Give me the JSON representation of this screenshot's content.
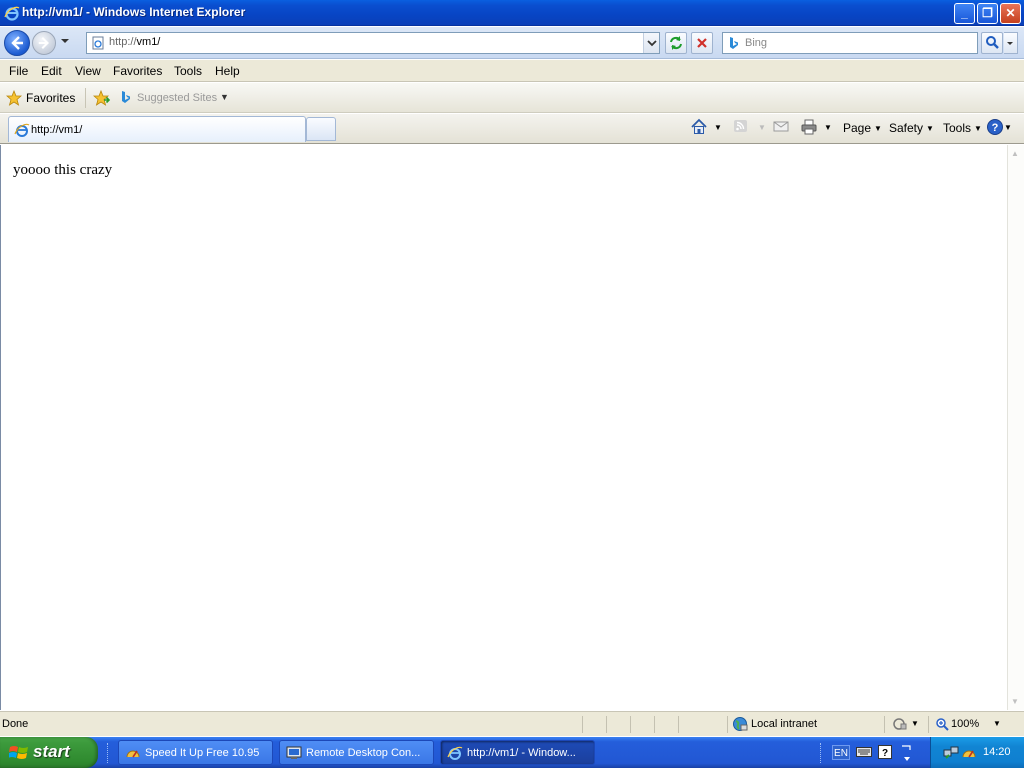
{
  "window": {
    "title": "http://vm1/ - Windows Internet Explorer",
    "minimize": "_",
    "restore": "❐",
    "close": "✕"
  },
  "address": {
    "url_prefix": "http://",
    "url_host": "vm1/",
    "search_placeholder": "Bing"
  },
  "menu": {
    "items": [
      "File",
      "Edit",
      "View",
      "Favorites",
      "Tools",
      "Help"
    ]
  },
  "favorites_bar": {
    "favorites_label": "Favorites",
    "suggested_sites_label": "Suggested Sites"
  },
  "tabs": {
    "active_label": "http://vm1/"
  },
  "command_bar": {
    "page_label": "Page",
    "safety_label": "Safety",
    "tools_label": "Tools"
  },
  "page": {
    "body_text": "yoooo this crazy"
  },
  "status": {
    "text": "Done",
    "zone": "Local intranet",
    "zoom": "100%"
  },
  "taskbar": {
    "start_label": "start",
    "tasks": [
      {
        "label": "Speed It Up Free 10.95"
      },
      {
        "label": "Remote Desktop Con..."
      },
      {
        "label": "http://vm1/ - Window..."
      }
    ],
    "language": "EN",
    "clock": "14:20"
  },
  "colors": {
    "title_bar": "#0a4fd0",
    "taskbar": "#245edb",
    "start_button": "#3c9a3c",
    "tray": "#1185d3"
  }
}
